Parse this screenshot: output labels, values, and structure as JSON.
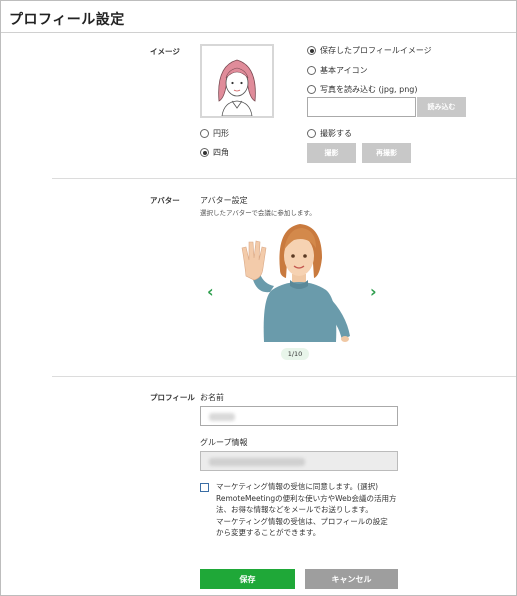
{
  "page": {
    "title": "プロフィール設定"
  },
  "image_section": {
    "label": "イメージ",
    "options": {
      "saved": "保存したプロフィールイメージ",
      "basic": "基本アイコン",
      "upload": "写真を読み込む (jpg, png)",
      "capture": "撮影する"
    },
    "selected_option": "saved",
    "load_button": "読み込む",
    "shape_circle": "円形",
    "shape_square": "四角",
    "selected_shape": "square",
    "capture_button": "撮影",
    "recapture_button": "再撮影"
  },
  "avatar_section": {
    "label": "アバター",
    "heading": "アバター設定",
    "description": "選択したアバターで会議に参加します。",
    "pager": "1/10",
    "prev_icon": "chevron-left-icon",
    "next_icon": "chevron-right-icon"
  },
  "profile_section": {
    "label": "プロフィール",
    "name_label": "お名前",
    "group_label": "グループ情報",
    "consent_line1": "マーケティング情報の受信に同意します。(選択)",
    "consent_line2": "RemoteMeetingの便利な使い方やWeb会議の活用方",
    "consent_line3": "法、お得な情報などをメールでお送りします。",
    "consent_line4": "マーケティング情報の受信は、プロフィールの設定",
    "consent_line5": "から変更することができます。"
  },
  "actions": {
    "save": "保存",
    "cancel": "キャンセル"
  },
  "colors": {
    "accent": "#1fa838",
    "cancel": "#9e9e9e",
    "disabled": "#c8c8c8",
    "arrow": "#2e9e4d"
  }
}
